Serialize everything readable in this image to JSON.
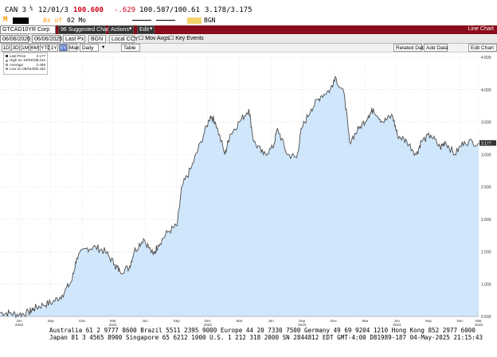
{
  "quote": {
    "ticker": "CAN 3",
    "fraction": "¼",
    "maturity": "12/01/3",
    "price": "100.600",
    "change": "-.629",
    "bid_ask": "100.587/100.61",
    "yield": "3.178/3.175"
  },
  "subheader": {
    "flag": "M",
    "asof_label": "As of",
    "asof_value": "02 Mo",
    "source": "BGN"
  },
  "toolbar1": {
    "security": "GTCAD10YR Corp",
    "suggested": "96 Suggested Charts",
    "actions": "Actions",
    "edit": "Edit",
    "title": "Line Chart"
  },
  "toolbar2": {
    "start_date": "06/06/2020",
    "end_date": "06/06/2025",
    "last_px": "Last Px",
    "bgn": "BGN",
    "ccy": "Local CCY",
    "mov_avgs": "Mov Avgs",
    "key_events": "Key Events"
  },
  "toolbar3": {
    "periods": [
      "1D",
      "3D",
      "1M",
      "6M",
      "YTD",
      "1Y",
      "5Y",
      "Max"
    ],
    "active_period": "5Y",
    "frequency": "Daily",
    "table": "Table",
    "related_data": "Related Data",
    "add_data": "Add Data",
    "edit_chart": "Edit Chart"
  },
  "legend": {
    "rows": [
      {
        "label": "Last Price",
        "value": "3.177"
      },
      {
        "label": "High on 10/03/23",
        "value": "4.242"
      },
      {
        "label": "Average",
        "value": "2.469"
      },
      {
        "label": "Low on 08/04/20",
        "value": "0.430"
      }
    ]
  },
  "footer": {
    "line1": "Australia 61 2 9777 8600  Brazil 5511 2395 9000  Europe 44 20 7330 7500  Germany 49 69 9204 1210  Hong Kong 852 2977 6000",
    "line2": "Japan 81 3 4565 8900        Singapore 65 6212 1000        U.S. 1 212 318 2000             SN 2844812 EDT  GMT-4:00 D81989-187 04-May-2025 21:15:43"
  },
  "chart_data": {
    "type": "area",
    "y_axis": {
      "min": 0.5,
      "max": 4.5,
      "tick_labels": [
        "4.500",
        "4.000",
        "3.500",
        "3.000",
        "2.500",
        "2.000",
        "1.500",
        "1.000",
        "0.500"
      ],
      "position": "right"
    },
    "last_value_label": "3.177",
    "x_ticks": [
      {
        "t": 0.04,
        "label": "Jun"
      },
      {
        "t": 0.106,
        "label": "Sep"
      },
      {
        "t": 0.172,
        "label": "Dec"
      },
      {
        "t": 0.236,
        "label": "Mar"
      },
      {
        "t": 0.303,
        "label": "Jun"
      },
      {
        "t": 0.369,
        "label": "Sep"
      },
      {
        "t": 0.434,
        "label": "Dec"
      },
      {
        "t": 0.5,
        "label": "Mar"
      },
      {
        "t": 0.566,
        "label": "Jun"
      },
      {
        "t": 0.631,
        "label": "Sep"
      },
      {
        "t": 0.697,
        "label": "Dec"
      },
      {
        "t": 0.763,
        "label": "Mar"
      },
      {
        "t": 0.829,
        "label": "Jun"
      },
      {
        "t": 0.895,
        "label": "Sep"
      },
      {
        "t": 0.961,
        "label": "Dec"
      },
      {
        "t": 1.0,
        "label": "Mar"
      }
    ],
    "years": [
      {
        "t": 0.04,
        "label": "2020"
      },
      {
        "t": 0.236,
        "label": "2021"
      },
      {
        "t": 0.434,
        "label": "2022"
      },
      {
        "t": 0.631,
        "label": "2023"
      },
      {
        "t": 0.829,
        "label": "2024"
      },
      {
        "t": 1.0,
        "label": "2025"
      }
    ],
    "series": [
      {
        "points": [
          [
            0.0,
            0.56
          ],
          [
            0.02,
            0.55
          ],
          [
            0.04,
            0.53
          ],
          [
            0.06,
            0.56
          ],
          [
            0.07,
            0.62
          ],
          [
            0.09,
            0.68
          ],
          [
            0.11,
            0.72
          ],
          [
            0.13,
            0.83
          ],
          [
            0.15,
            1.05
          ],
          [
            0.16,
            1.4
          ],
          [
            0.18,
            1.55
          ],
          [
            0.2,
            1.57
          ],
          [
            0.22,
            1.5
          ],
          [
            0.24,
            1.3
          ],
          [
            0.25,
            1.2
          ],
          [
            0.27,
            1.25
          ],
          [
            0.28,
            1.5
          ],
          [
            0.3,
            1.7
          ],
          [
            0.32,
            1.45
          ],
          [
            0.33,
            1.6
          ],
          [
            0.35,
            1.8
          ],
          [
            0.37,
            1.9
          ],
          [
            0.38,
            2.5
          ],
          [
            0.4,
            2.8
          ],
          [
            0.42,
            3.2
          ],
          [
            0.44,
            3.6
          ],
          [
            0.45,
            3.5
          ],
          [
            0.47,
            3.0
          ],
          [
            0.48,
            3.3
          ],
          [
            0.5,
            3.5
          ],
          [
            0.52,
            3.7
          ],
          [
            0.53,
            3.2
          ],
          [
            0.55,
            3.0
          ],
          [
            0.57,
            3.1
          ],
          [
            0.58,
            3.4
          ],
          [
            0.6,
            3.0
          ],
          [
            0.62,
            2.95
          ],
          [
            0.63,
            3.4
          ],
          [
            0.65,
            3.7
          ],
          [
            0.67,
            3.9
          ],
          [
            0.69,
            4.0
          ],
          [
            0.7,
            4.2
          ],
          [
            0.72,
            3.9
          ],
          [
            0.73,
            3.2
          ],
          [
            0.75,
            3.4
          ],
          [
            0.77,
            3.6
          ],
          [
            0.78,
            3.7
          ],
          [
            0.8,
            3.5
          ],
          [
            0.82,
            3.6
          ],
          [
            0.83,
            3.3
          ],
          [
            0.85,
            3.2
          ],
          [
            0.87,
            3.0
          ],
          [
            0.88,
            3.2
          ],
          [
            0.9,
            3.3
          ],
          [
            0.92,
            3.1
          ],
          [
            0.93,
            3.2
          ],
          [
            0.95,
            3.0
          ],
          [
            0.97,
            3.2
          ],
          [
            1.0,
            3.18
          ]
        ]
      }
    ]
  }
}
